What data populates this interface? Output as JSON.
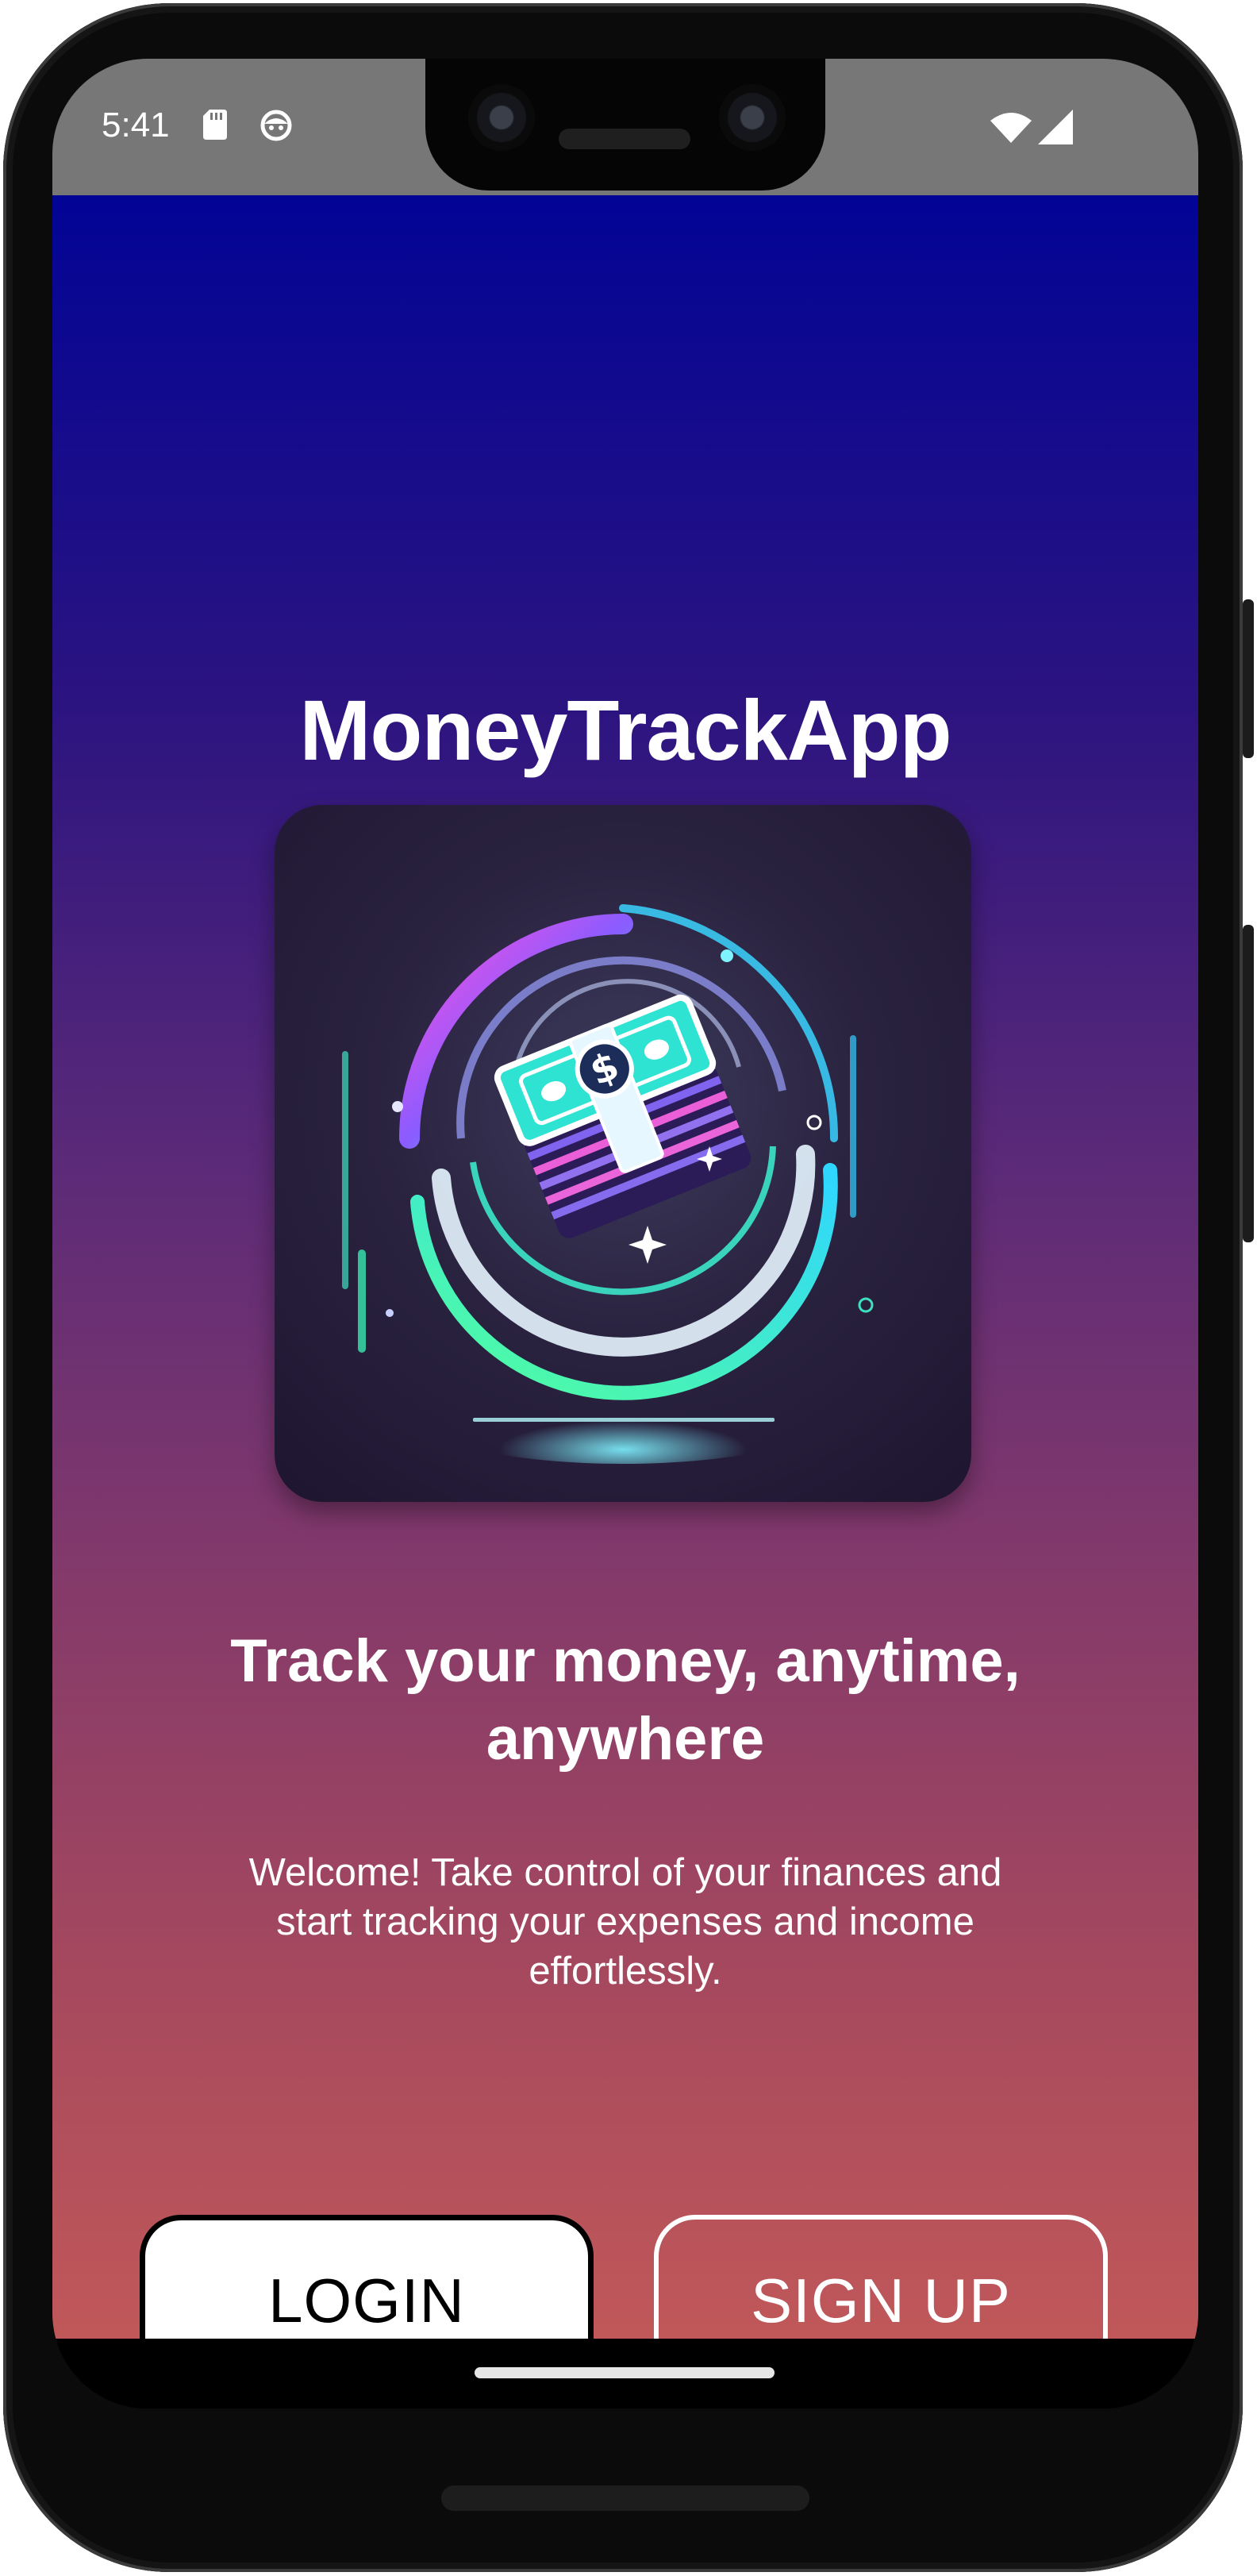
{
  "status_bar": {
    "time": "5:41",
    "icons": [
      "sd-card-icon",
      "face-icon",
      "wifi-icon",
      "signal-icon"
    ]
  },
  "app": {
    "title": "MoneyTrackApp",
    "logo_icon": "money-stack-logo-icon",
    "tagline": "Track your money, anytime, anywhere",
    "welcome_text": "Welcome! Take control of your finances and start tracking your expenses and income effortlessly.",
    "login_label": "LOGIN",
    "signup_label": "SIGN UP",
    "colors": {
      "gradient_top": "#020496",
      "gradient_bottom": "#c05859",
      "login_bg": "#ffffff",
      "status_bar": "#777777"
    }
  },
  "nav": {
    "home_indicator": "home-indicator"
  }
}
